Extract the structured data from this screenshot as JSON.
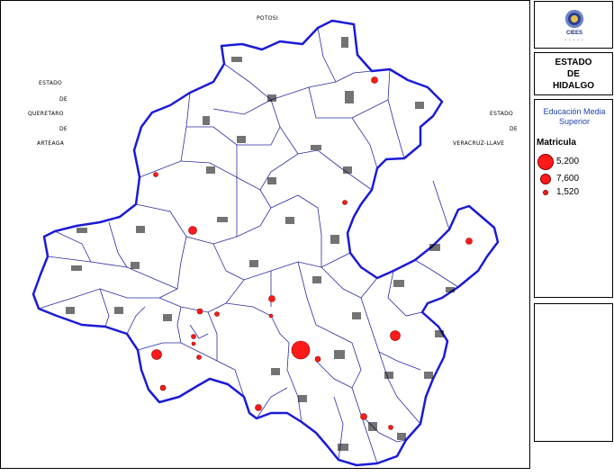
{
  "map": {
    "labels": {
      "north": "POTOSI",
      "west_line1": "ESTADO",
      "west_line2": "DE",
      "west_line3": "QUERETARO",
      "west_line4": "DE",
      "west_line5": "ARTEAGA",
      "east_line1": "ESTADO",
      "east_line2": "DE",
      "east_line3": "VERACRUZ-LLAVE"
    },
    "colors": {
      "border": "#1a1ad6",
      "municipio": "#2a2aa0",
      "symbol": "#ff1a1a"
    }
  },
  "logo": {
    "name": "CIEES",
    "sub": "* * * * *"
  },
  "title": {
    "line1": "ESTADO",
    "line2": "DE",
    "line3": "HIDALGO"
  },
  "legend": {
    "subtitle_line1": "Educación Media",
    "subtitle_line2": "Superior",
    "heading": "Matricula",
    "items": [
      {
        "label": "5,200",
        "size": "large"
      },
      {
        "label": "7,600",
        "size": "medium"
      },
      {
        "label": "1,520",
        "size": "small"
      }
    ]
  }
}
